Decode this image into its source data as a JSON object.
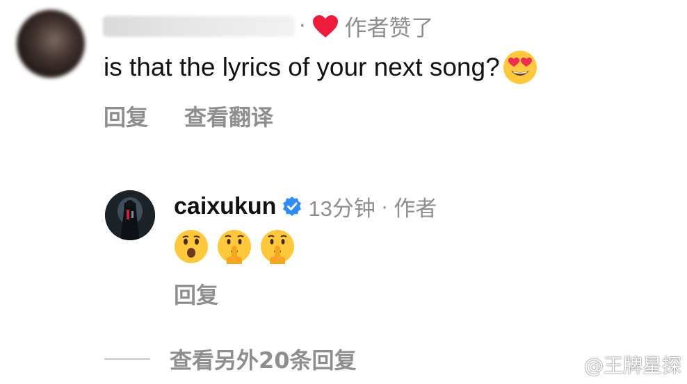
{
  "top_comment": {
    "meta_dot": "·",
    "liked_label": "作者赞了",
    "text": "is that the lyrics of your next song?",
    "emoji": "smiling-face-with-heart-eyes",
    "actions": {
      "reply": "回复",
      "translate": "查看翻译"
    }
  },
  "reply": {
    "username": "caixukun",
    "time": "13分钟",
    "dot": "·",
    "author_badge": "作者",
    "emojis": [
      "face-with-open-mouth",
      "shushing-face",
      "shushing-face"
    ],
    "reply_label": "回复"
  },
  "view_more": {
    "label": "查看另外20条回复"
  },
  "watermark": {
    "text": "@王牌星探"
  },
  "colors": {
    "heart": "#ed1c3a",
    "verified": "#2f8cf5",
    "secondary_text": "#8e8e8e",
    "primary_text": "#111111",
    "emoji_yellow": "#ffc83d"
  }
}
